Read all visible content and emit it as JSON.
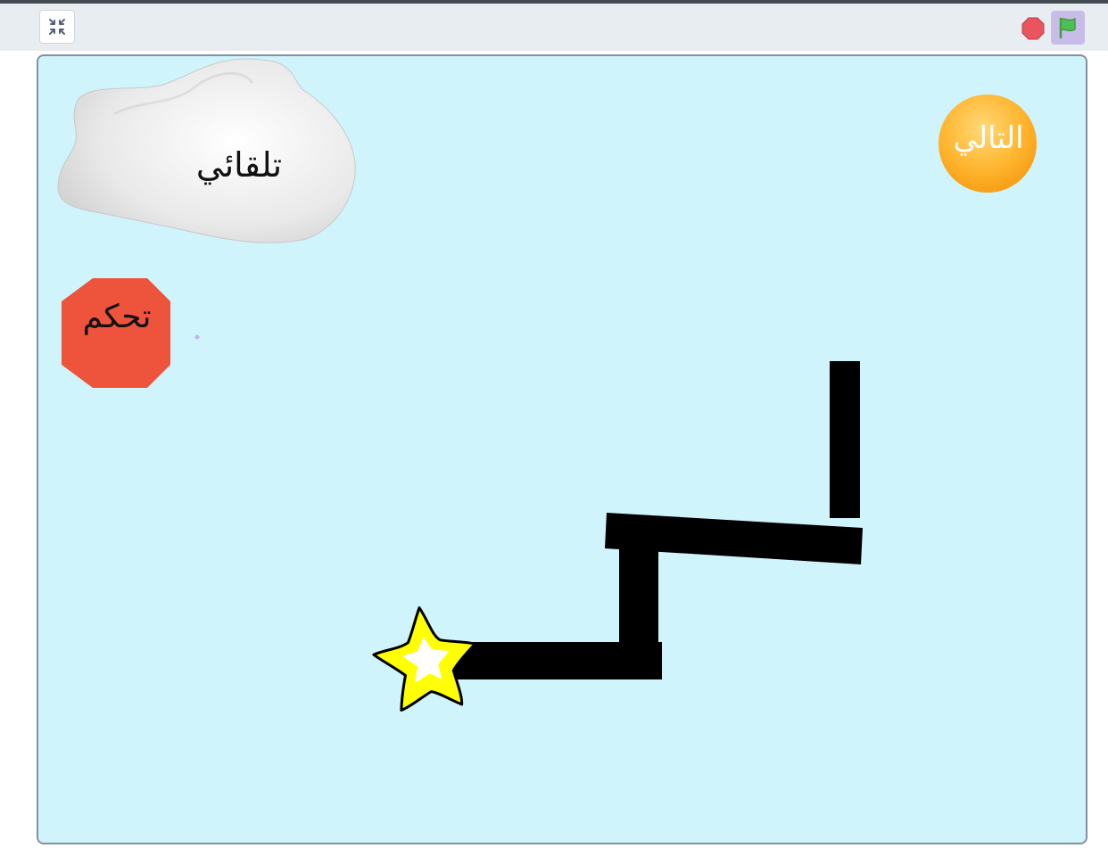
{
  "toolbar": {
    "unfullscreen_icon": "unfullscreen-icon",
    "stop_icon": "stop-icon",
    "green_flag_icon": "green-flag-icon",
    "colors": {
      "background": "#e8edf2",
      "stop": "#e9545d",
      "flag_button_bg": "#c8bde9",
      "flag": "#4cbf56"
    }
  },
  "stage": {
    "background_color": "#cff4fc",
    "sprites": {
      "cloud_button": {
        "label": "تلقائي",
        "icon": "cloud-icon"
      },
      "next_button": {
        "label": "التالي",
        "icon": "orange-circle"
      },
      "control_button": {
        "label": "تحكم",
        "icon": "stop-sign-octagon"
      },
      "star": {
        "icon": "star-icon",
        "fill": "#ffff00"
      },
      "path_color": "#000000"
    }
  }
}
